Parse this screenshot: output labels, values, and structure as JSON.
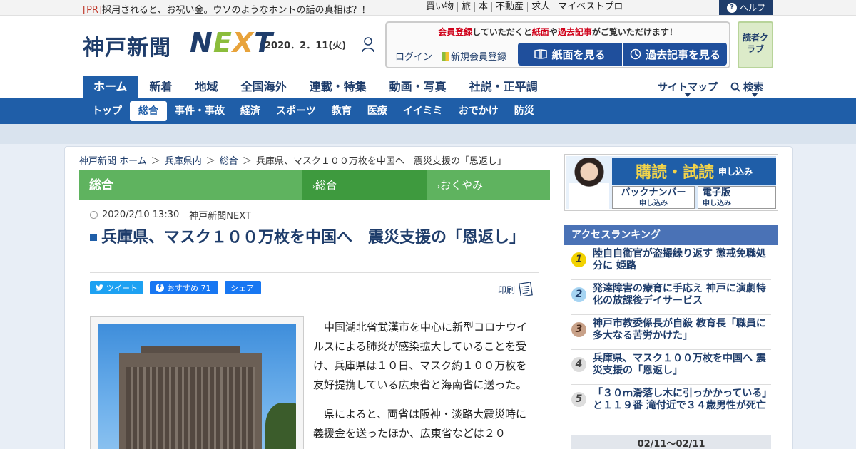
{
  "topbar": {
    "pr_tag": "[PR]",
    "pr_text": "採用されると、お祝い金。ウソのようなホントの話の真相は？！",
    "links": [
      "買い物",
      "旅",
      "本",
      "不動産",
      "求人",
      "マイベストプロ"
    ],
    "help_label": "ヘルプ"
  },
  "header": {
    "logo_kanji": "神戸新聞",
    "logo_next": {
      "n": "N",
      "e": "E",
      "x": "X",
      "t": "T"
    },
    "date": "2020．2．11(火)",
    "member_msg_1": "会員登録",
    "member_msg_2": "していただくと",
    "member_msg_3": "紙面",
    "member_msg_4": "や",
    "member_msg_5": "過去記事",
    "member_msg_6": "がご覧いただけます！",
    "login_label": "ログイン",
    "signup_label": "新規会員登録",
    "paper_btn": "紙面を見る",
    "past_btn": "過去記事を見る",
    "reader_club": "読者クラブ"
  },
  "main_nav": [
    "ホーム",
    "新着",
    "地域",
    "全国海外",
    "連載・特集",
    "動画・写真",
    "社説・正平調"
  ],
  "sitemap_label": "サイトマップ",
  "search_label": "検索",
  "sub_nav": [
    "トップ",
    "総合",
    "事件・事故",
    "経済",
    "スポーツ",
    "教育",
    "医療",
    "イイミミ",
    "おでかけ",
    "防災"
  ],
  "breadcrumb": [
    "神戸新聞 ホーム",
    "兵庫県内",
    "総合",
    "兵庫県、マスク１００万枚を中国へ　震災支援の「恩返し」"
  ],
  "category_bar": {
    "main": "総合",
    "tab1": "総合",
    "tab2": "おくやみ"
  },
  "article": {
    "datetime": "2020/2/10 13:30",
    "source": "神戸新聞NEXT",
    "headline": "兵庫県、マスク１００万枚を中国へ　震災支援の「恩返し」",
    "tweet_label": "ツイート",
    "fb_label": "おすすめ 71",
    "share_label": "シェア",
    "print_label": "印刷",
    "para1": "中国湖北省武漢市を中心に新型コロナウイルスによる肺炎が感染拡大していることを受け、兵庫県は１０日、マスク約１００万枚を友好提携している広東省と海南省に送った。",
    "para2": "県によると、両省は阪神・淡路大震災時に義援金を送ったほか、広東省などは２０"
  },
  "ad": {
    "top": "購読・試読",
    "top_small": "申し込み",
    "backnumber": "バックナンバー",
    "backnumber_small": "申し込み",
    "digital": "電子版",
    "digital_small": "申し込み"
  },
  "ranking": {
    "title": "アクセスランキング",
    "items": [
      {
        "num": "1",
        "text": "陸自自衛官が盗撮繰り返す 懲戒免職処分に 姫路"
      },
      {
        "num": "2",
        "text": "発達障害の療育に手応え 神戸に演劇特化の放課後デイサービス"
      },
      {
        "num": "3",
        "text": "神戸市教委係長が自殺 教育長「職員に多大なる苦労かけた」"
      },
      {
        "num": "4",
        "text": "兵庫県、マスク１００万枚を中国へ 震災支援の「恩返し」"
      },
      {
        "num": "5",
        "text": "「３０ｍ滑落し木に引っかかっている」と１１９番 滝付近で３４歳男性が死亡"
      }
    ],
    "date_range": "02/11～02/11"
  }
}
